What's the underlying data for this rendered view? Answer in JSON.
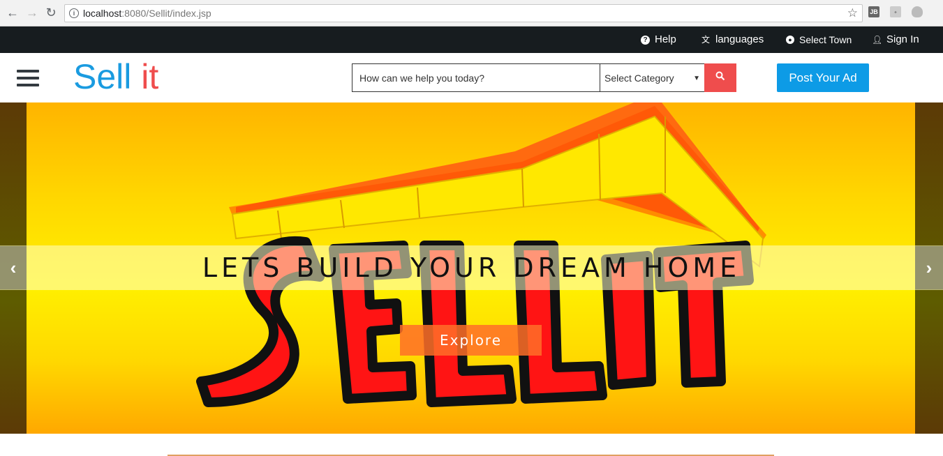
{
  "browser": {
    "url_host": "localhost",
    "url_rest": ":8080/Sellit/index.jsp",
    "ext_jb": "JB"
  },
  "topbar": {
    "help": "Help",
    "languages": "languages",
    "select_town": "Select Town",
    "sign_in": "Sign In"
  },
  "header": {
    "logo_sell": "Sell",
    "logo_it": "it",
    "search_placeholder": "How can we help you today?",
    "category_selected": "Select Category",
    "post_ad": "Post Your Ad"
  },
  "carousel": {
    "caption": "LETS BUILD YOUR DREAM HOME",
    "explore": "Explore",
    "prev": "‹",
    "next": "›"
  },
  "colors": {
    "topbar_bg": "#171c1f",
    "logo_sell": "#1a9be0",
    "logo_it": "#ef4d4d",
    "search_btn": "#ef4d4d",
    "post_ad_bg": "#0d9be6",
    "explore_bg": "#ff6e28"
  },
  "icons": [
    "back-icon",
    "forward-icon",
    "reload-icon",
    "info-icon",
    "star-icon",
    "help-icon",
    "language-icon",
    "globe-icon",
    "user-icon",
    "hamburger-menu-icon",
    "search-icon"
  ]
}
